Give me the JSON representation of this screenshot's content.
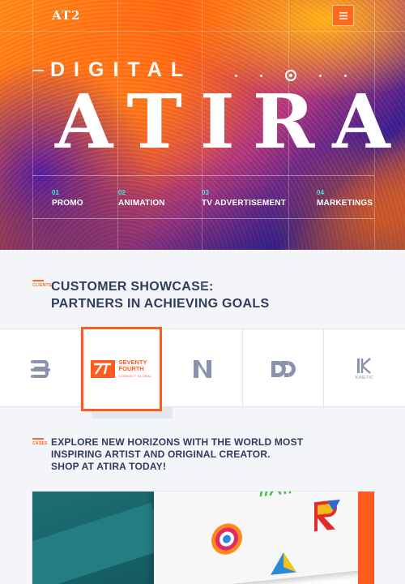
{
  "header": {
    "logo_text": "AT2",
    "menu_icon": "hamburger-icon"
  },
  "hero": {
    "eyebrow": "DIGITAL",
    "title": "ATIRA",
    "services": [
      {
        "num": "01",
        "label": "PROMO"
      },
      {
        "num": "02",
        "label": "ANIMATION"
      },
      {
        "num": "03",
        "label": "TV ADVERTISEMENT"
      },
      {
        "num": "04",
        "label": "MARKETINGS"
      }
    ]
  },
  "customers": {
    "tag": "CLIENTS",
    "headline_line1": "CUSTOMER SHOWCASE:",
    "headline_line2": "PARTNERS IN ACHIEVING GOALS",
    "logos": [
      {
        "icon": "ss-logo-icon"
      },
      {
        "icon": "seventy-fourth-logo-icon",
        "name_line1": "SEVENTY",
        "name_line2": "FOURTH",
        "tagline": "CONNECT GLOBAL"
      },
      {
        "icon": "n-logo-icon"
      },
      {
        "icon": "dd-logo-icon"
      },
      {
        "icon": "kinetic-logo-icon",
        "name": "KINETIC"
      }
    ]
  },
  "cases": {
    "tag": "CASES",
    "headline_line1": "EXPLORE NEW HORIZONS WITH THE WORLD MOST",
    "headline_line2": "INSPIRING ARTIST AND ORIGINAL CREATOR.",
    "headline_line3": "SHOP AT ATIRA TODAY!"
  },
  "colors": {
    "accent": "#ff5a1f",
    "teal": "#4ee0d8",
    "heading": "#2f3c5e"
  }
}
